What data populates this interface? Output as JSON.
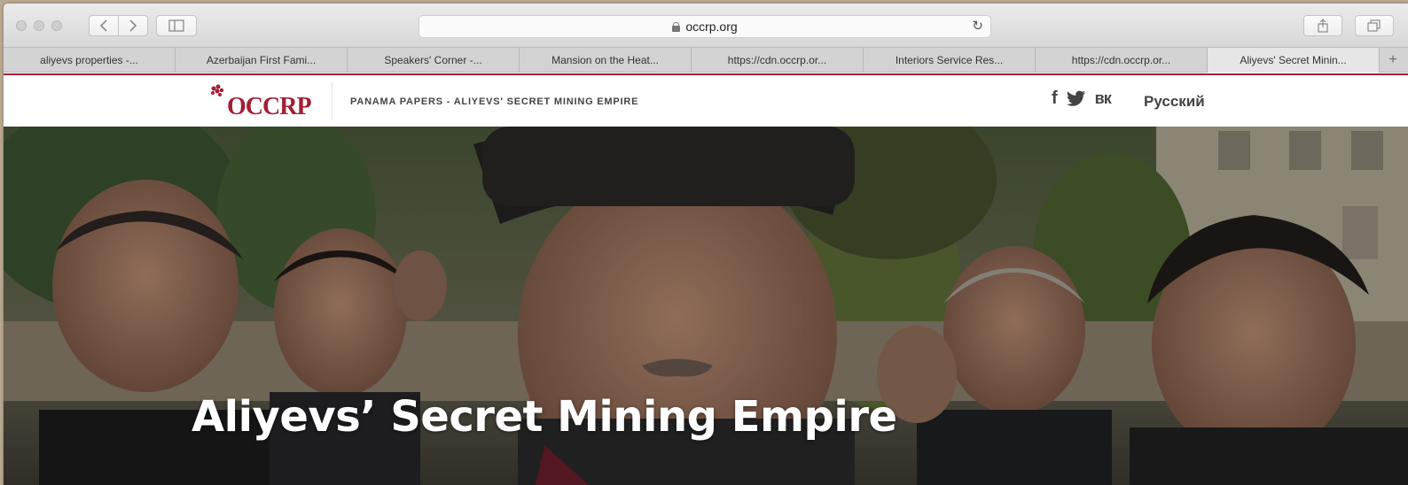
{
  "browser": {
    "url": "occrp.org",
    "tabs": [
      {
        "label": "aliyevs properties -..."
      },
      {
        "label": "Azerbaijan First Fami..."
      },
      {
        "label": "Speakers' Corner -..."
      },
      {
        "label": "Mansion on the Heat..."
      },
      {
        "label": "https://cdn.occrp.or..."
      },
      {
        "label": "Interiors Service Res..."
      },
      {
        "label": "https://cdn.occrp.or..."
      },
      {
        "label": "Aliyevs' Secret Minin..."
      }
    ],
    "new_tab": "+"
  },
  "site": {
    "logo_text": "OCCRP",
    "section_title": "PANAMA PAPERS - ALIYEVS' SECRET MINING EMPIRE",
    "social": {
      "facebook": "f",
      "twitter": "🐦",
      "vk": "vk"
    },
    "language": "Русский",
    "accent_color": "#a41e34"
  },
  "hero": {
    "title": "Aliyevs’ Secret Mining Empire"
  }
}
